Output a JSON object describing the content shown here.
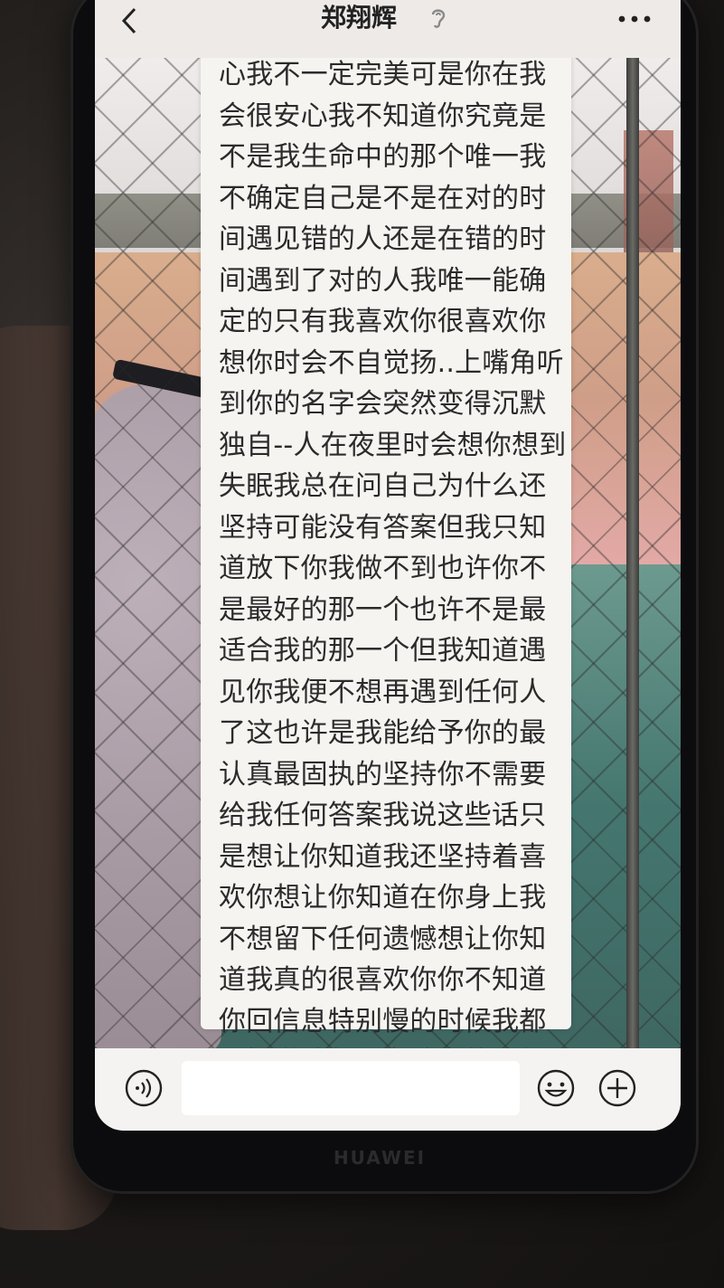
{
  "header": {
    "title": "郑翔辉",
    "icons": {
      "back": "chevron-left-icon",
      "muted": "ear-icon",
      "more": "more-dots-icon"
    }
  },
  "conversation": {
    "messages": [
      {
        "sender": "contact",
        "text": "心我不一定完美可是你在我会很安心我不知道你究竟是不是我生命中的那个唯一我不确定自己是不是在对的时间遇见错的人还是在错的时间遇到了对的人我唯一能确定的只有我喜欢你很喜欢你想你时会不自觉扬..上嘴角听到你的名字会突然变得沉默独自--人在夜里时会想你想到失眠我总在问自己为什么还坚持可能没有答案但我只知道放下你我做不到也许你不是最好的那一个也许不是最适合我的那一个但我知道遇见你我便不想再遇到任何人了这也许是我能给予你的最认真最固执的坚持你不需要给我任何答案我说这些话只是想让你知道我还坚持着喜欢你想让你知道在你身上我不想留下任何遗憾想让你知道我真的很喜欢你你不知道你回信息特别慢的时候我都不知道该怎么办该说的我都说了所以天气好冷啊能不能给我转五块钱买个烤红薯?"
      }
    ]
  },
  "input_bar": {
    "value": "",
    "icons": {
      "voice": "voice-icon",
      "emoji": "emoji-icon",
      "plus": "plus-icon"
    }
  },
  "device": {
    "brand": "HUAWEI"
  },
  "colors": {
    "bubble": "#f6f4f1",
    "text": "#2b2b2b",
    "topbar": "#eeeae8",
    "input_bar": "#f4f3f2"
  }
}
